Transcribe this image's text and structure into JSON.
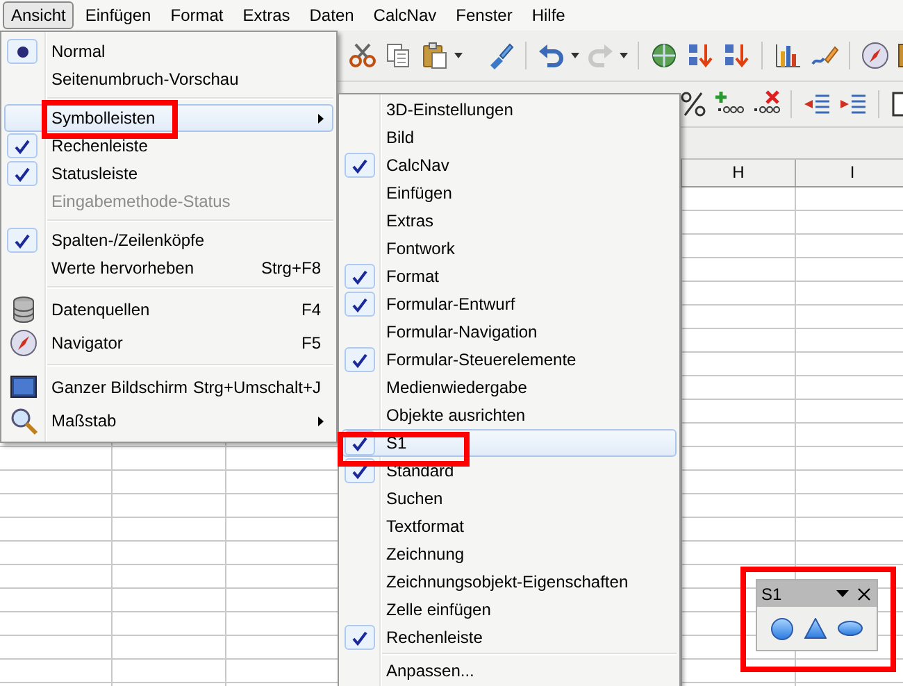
{
  "menubar": [
    {
      "label": "Ansicht",
      "selected": true
    },
    {
      "label": "Einfügen",
      "selected": false
    },
    {
      "label": "Format",
      "selected": false
    },
    {
      "label": "Extras",
      "selected": false
    },
    {
      "label": "Daten",
      "selected": false
    },
    {
      "label": "CalcNav",
      "selected": false
    },
    {
      "label": "Fenster",
      "selected": false
    },
    {
      "label": "Hilfe",
      "selected": false
    }
  ],
  "view_menu": {
    "items": [
      {
        "kind": "radio",
        "label": "Normal",
        "checked": true,
        "selected": false,
        "disabled": false
      },
      {
        "kind": "radio",
        "label": "Seitenumbruch-Vorschau",
        "checked": false,
        "selected": false,
        "disabled": false
      },
      {
        "kind": "separator"
      },
      {
        "kind": "submenu",
        "label": "Symbolleisten",
        "selected": true,
        "disabled": false
      },
      {
        "kind": "check",
        "label": "Rechenleiste",
        "checked": true,
        "selected": false,
        "disabled": false
      },
      {
        "kind": "check",
        "label": "Statusleiste",
        "checked": true,
        "selected": false,
        "disabled": false
      },
      {
        "kind": "check",
        "label": "Eingabemethode-Status",
        "checked": false,
        "selected": false,
        "disabled": true
      },
      {
        "kind": "separator"
      },
      {
        "kind": "check",
        "label": "Spalten-/Zeilenköpfe",
        "checked": true,
        "selected": false,
        "disabled": false
      },
      {
        "kind": "check",
        "label": "Werte hervorheben",
        "shortcut": "Strg+F8",
        "checked": false,
        "selected": false,
        "disabled": false
      },
      {
        "kind": "separator"
      },
      {
        "kind": "command",
        "label": "Datenquellen",
        "shortcut": "F4",
        "selected": false,
        "disabled": false
      },
      {
        "kind": "command",
        "label": "Navigator",
        "shortcut": "F5",
        "selected": false,
        "disabled": false
      },
      {
        "kind": "separator"
      },
      {
        "kind": "command",
        "label": "Ganzer Bildschirm",
        "shortcut": "Strg+Umschalt+J",
        "selected": false,
        "disabled": false
      },
      {
        "kind": "command_submenu",
        "label": "Maßstab",
        "selected": false,
        "disabled": false
      }
    ]
  },
  "toolbars_menu": {
    "items": [
      {
        "kind": "check",
        "label": "3D-Einstellungen",
        "checked": false,
        "selected": false
      },
      {
        "kind": "check",
        "label": "Bild",
        "checked": false,
        "selected": false
      },
      {
        "kind": "check",
        "label": "CalcNav",
        "checked": true,
        "selected": false
      },
      {
        "kind": "check",
        "label": "Einfügen",
        "checked": false,
        "selected": false
      },
      {
        "kind": "check",
        "label": "Extras",
        "checked": false,
        "selected": false
      },
      {
        "kind": "check",
        "label": "Fontwork",
        "checked": false,
        "selected": false
      },
      {
        "kind": "check",
        "label": "Format",
        "checked": true,
        "selected": false
      },
      {
        "kind": "check",
        "label": "Formular-Entwurf",
        "checked": true,
        "selected": false
      },
      {
        "kind": "check",
        "label": "Formular-Navigation",
        "checked": false,
        "selected": false
      },
      {
        "kind": "check",
        "label": "Formular-Steuerelemente",
        "checked": true,
        "selected": false
      },
      {
        "kind": "check",
        "label": "Medienwiedergabe",
        "checked": false,
        "selected": false
      },
      {
        "kind": "check",
        "label": "Objekte ausrichten",
        "checked": false,
        "selected": false
      },
      {
        "kind": "check",
        "label": "S1",
        "checked": true,
        "selected": true
      },
      {
        "kind": "check",
        "label": "Standard",
        "checked": true,
        "selected": false
      },
      {
        "kind": "check",
        "label": "Suchen",
        "checked": false,
        "selected": false
      },
      {
        "kind": "check",
        "label": "Textformat",
        "checked": false,
        "selected": false
      },
      {
        "kind": "check",
        "label": "Zeichnung",
        "checked": false,
        "selected": false
      },
      {
        "kind": "check",
        "label": "Zeichnungsobjekt-Eigenschaften",
        "checked": false,
        "selected": false
      },
      {
        "kind": "check",
        "label": "Zelle einfügen",
        "checked": false,
        "selected": false
      },
      {
        "kind": "check",
        "label": "Rechenleiste",
        "checked": true,
        "selected": false
      },
      {
        "kind": "separator"
      },
      {
        "kind": "command",
        "label": "Anpassen...",
        "selected": false
      }
    ]
  },
  "sheet": {
    "columns": [
      "H",
      "I"
    ]
  },
  "floating_toolbar": {
    "title": "S1"
  }
}
